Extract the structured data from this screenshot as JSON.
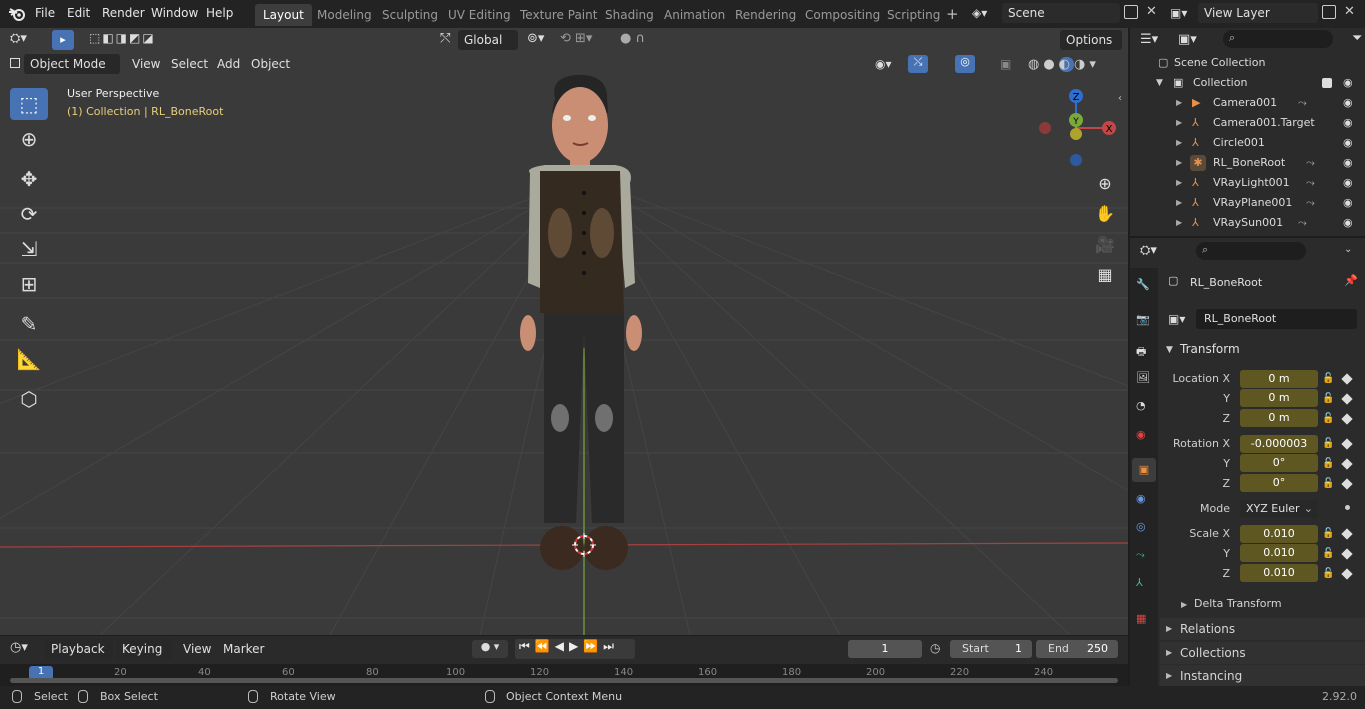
{
  "app": {
    "logo_icon": "blender-logo-icon",
    "menus": [
      "File",
      "Edit",
      "Render",
      "Window",
      "Help"
    ],
    "workspaces": [
      "Layout",
      "Modeling",
      "Sculpting",
      "UV Editing",
      "Texture Paint",
      "Shading",
      "Animation",
      "Rendering",
      "Compositing",
      "Scripting"
    ],
    "active_workspace": "Layout",
    "add_workspace": "+",
    "scene": "Scene",
    "view_layer": "View Layer"
  },
  "viewport": {
    "mode": "Object Mode",
    "menus": [
      "View",
      "Select",
      "Add",
      "Object"
    ],
    "transform_orientation": "Global",
    "options_label": "Options",
    "overlay_title": "User Perspective",
    "overlay_context": "(1) Collection | RL_BoneRoot",
    "gizmo": {
      "z": "Z",
      "y": "Y",
      "x": "X"
    },
    "colors": {
      "background": "#3a3a3a",
      "x_axis": "#c24747",
      "y_axis": "#7ba83a",
      "z_axis": "#2e6fd1",
      "selection": "#e8cf7a",
      "active_tool": "#4772b3"
    },
    "tools": [
      "select-box-icon",
      "cursor-icon",
      "move-icon",
      "rotate-icon",
      "scale-icon",
      "transform-icon",
      "annotate-icon",
      "measure-icon",
      "add-cube-icon"
    ]
  },
  "timeline": {
    "menus": [
      "Playback",
      "Keying",
      "View",
      "Marker"
    ],
    "current_frame": "1",
    "start_label": "Start",
    "start": "1",
    "end_label": "End",
    "end": "250",
    "ruler": [
      "1",
      "20",
      "40",
      "60",
      "80",
      "100",
      "120",
      "140",
      "160",
      "180",
      "200",
      "220",
      "240"
    ]
  },
  "status": {
    "select": "Select",
    "box_select": "Box Select",
    "rotate_view": "Rotate View",
    "context_menu": "Object Context Menu",
    "version": "2.92.0"
  },
  "outliner": {
    "scene_collection": "Scene Collection",
    "collection": "Collection",
    "items": [
      {
        "name": "Camera001",
        "icon": "camera-object-icon"
      },
      {
        "name": "Camera001.Target",
        "icon": "empty-object-icon"
      },
      {
        "name": "Circle001",
        "icon": "empty-object-icon"
      },
      {
        "name": "RL_BoneRoot",
        "icon": "armature-object-icon"
      },
      {
        "name": "VRayLight001",
        "icon": "empty-object-icon"
      },
      {
        "name": "VRayPlane001",
        "icon": "empty-object-icon"
      },
      {
        "name": "VRaySun001",
        "icon": "empty-object-icon"
      }
    ]
  },
  "properties": {
    "object_name": "RL_BoneRoot",
    "datablock_name": "RL_BoneRoot",
    "transform_label": "Transform",
    "location": {
      "label": "Location X",
      "x": "0 m",
      "y_label": "Y",
      "y": "0 m",
      "z_label": "Z",
      "z": "0 m"
    },
    "rotation": {
      "label": "Rotation X",
      "x": "-0.000003",
      "y_label": "Y",
      "y": "0°",
      "z_label": "Z",
      "z": "0°"
    },
    "mode_label": "Mode",
    "mode": "XYZ Euler",
    "scale": {
      "label": "Scale X",
      "x": "0.010",
      "y_label": "Y",
      "y": "0.010",
      "z_label": "Z",
      "z": "0.010"
    },
    "delta_transform": "Delta Transform",
    "relations": "Relations",
    "collections": "Collections",
    "instancing": "Instancing"
  }
}
